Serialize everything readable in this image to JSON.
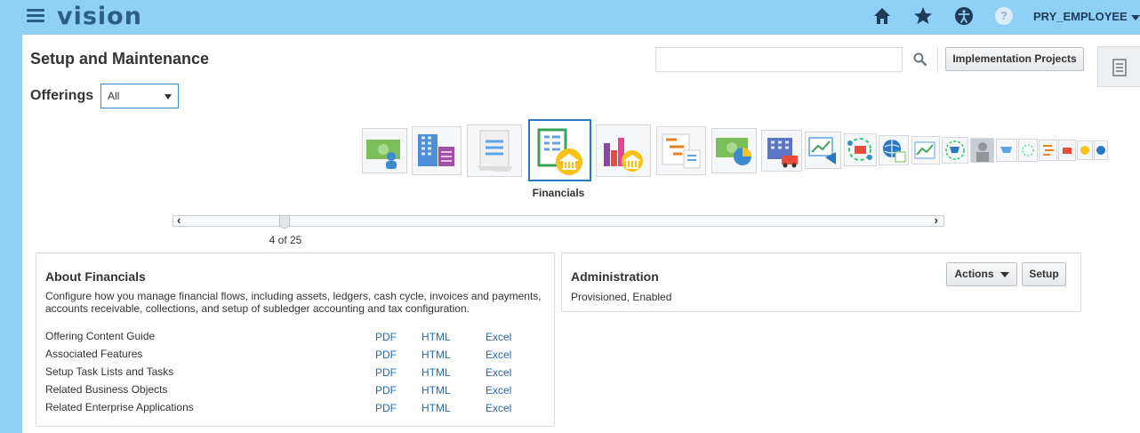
{
  "app": {
    "brand": "vision",
    "user": "PRY_EMPLOYEE",
    "icons": [
      "menu-icon",
      "home-icon",
      "favorites-star-icon",
      "accessibility-icon",
      "help-icon",
      "user-menu-caret-icon"
    ]
  },
  "page": {
    "title": "Setup and Maintenance",
    "impl_button": "Implementation Projects",
    "search_placeholder": ""
  },
  "offerings": {
    "label": "Offerings",
    "selected": "All"
  },
  "carousel": {
    "selected_label": "Financials",
    "position_text": "4 of 25",
    "position": 4,
    "total": 25
  },
  "about": {
    "title": "About Financials",
    "description": "Configure how you manage financial flows, including assets, ledgers, cash cycle, invoices and payments, accounts receivable, collections, and setup of subledger accounting and tax configuration.",
    "rows": [
      {
        "name": "Offering Content Guide",
        "pdf": "PDF",
        "html": "HTML",
        "excel": "Excel"
      },
      {
        "name": "Associated Features",
        "pdf": "PDF",
        "html": "HTML",
        "excel": "Excel"
      },
      {
        "name": "Setup Task Lists and Tasks",
        "pdf": "PDF",
        "html": "HTML",
        "excel": "Excel"
      },
      {
        "name": "Related Business Objects",
        "pdf": "PDF",
        "html": "HTML",
        "excel": "Excel"
      },
      {
        "name": "Related Enterprise Applications",
        "pdf": "PDF",
        "html": "HTML",
        "excel": "Excel"
      }
    ]
  },
  "admin": {
    "title": "Administration",
    "status": "Provisioned, Enabled",
    "actions_label": "Actions",
    "setup_label": "Setup"
  },
  "colors": {
    "header_bg": "#8fd0f6",
    "brand": "#2a5d8a",
    "link": "#1f6ab3",
    "selected_border": "#2a77c4"
  }
}
